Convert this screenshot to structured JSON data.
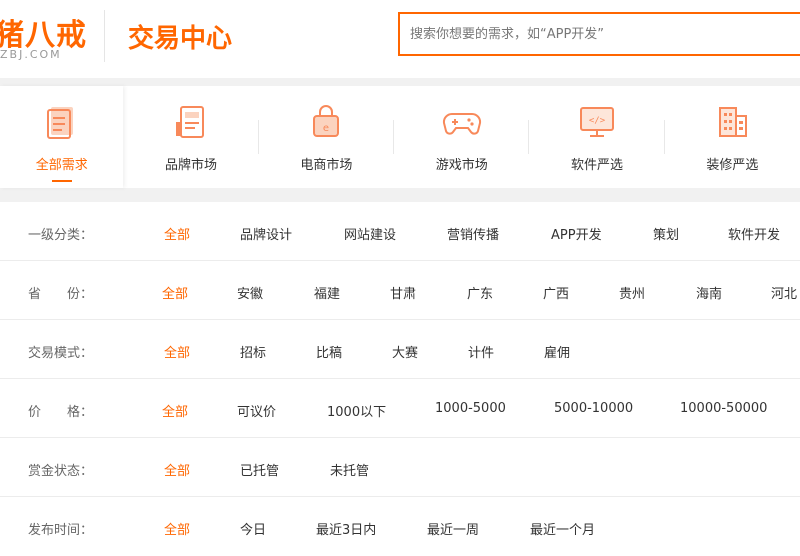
{
  "header": {
    "logo_main": "猪八戒",
    "logo_sub": "ZBJ.COM",
    "page_title": "交易中心",
    "search_placeholder": "搜索你想要的需求，如“APP开发”"
  },
  "categories": [
    {
      "label": "全部需求",
      "icon": "document-list-icon",
      "active": true
    },
    {
      "label": "品牌市场",
      "icon": "brand-folder-icon"
    },
    {
      "label": "电商市场",
      "icon": "shopping-bag-icon"
    },
    {
      "label": "游戏市场",
      "icon": "gamepad-icon"
    },
    {
      "label": "软件严选",
      "icon": "monitor-code-icon"
    },
    {
      "label": "装修严选",
      "icon": "building-icon"
    }
  ],
  "filters": {
    "level1": {
      "label": "一级分类：",
      "options": [
        "全部",
        "品牌设计",
        "网站建设",
        "营销传播",
        "APP开发",
        "策划",
        "软件开发"
      ]
    },
    "province": {
      "label": "省　　份：",
      "options": [
        "全部",
        "安徽",
        "福建",
        "甘肃",
        "广东",
        "广西",
        "贵州",
        "海南",
        "河北"
      ]
    },
    "mode": {
      "label": "交易模式：",
      "options": [
        "全部",
        "招标",
        "比稿",
        "大赛",
        "计件",
        "雇佣"
      ]
    },
    "price": {
      "label": "价　　格：",
      "options": [
        "全部",
        "可议价",
        "1000以下",
        "1000-5000",
        "5000-10000",
        "10000-50000"
      ]
    },
    "bounty": {
      "label": "赏金状态：",
      "options": [
        "全部",
        "已托管",
        "未托管"
      ]
    },
    "time": {
      "label": "发布时间：",
      "options": [
        "全部",
        "今日",
        "最近3日内",
        "最近一周",
        "最近一个月"
      ]
    }
  },
  "colors": {
    "accent": "#ff6600",
    "icon_tint": "#f8a07a"
  }
}
